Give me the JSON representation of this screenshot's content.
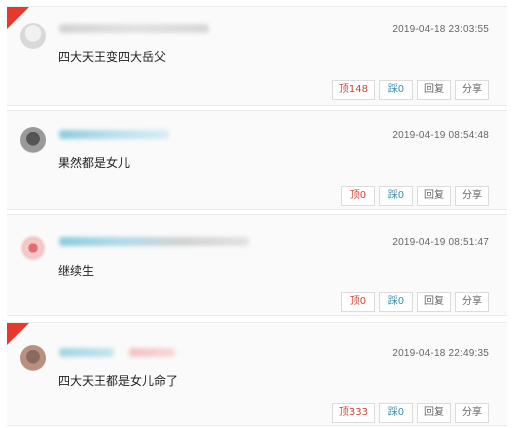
{
  "comments": [
    {
      "hot": true,
      "time": "2019-04-18 23:03:55",
      "text": "四大天王变四大岳父",
      "up_label": "顶148",
      "down_label": "踩0",
      "reply_label": "回复",
      "share_label": "分享"
    },
    {
      "hot": false,
      "time": "2019-04-19 08:54:48",
      "text": "果然都是女儿",
      "up_label": "顶0",
      "down_label": "踩0",
      "reply_label": "回复",
      "share_label": "分享"
    },
    {
      "hot": false,
      "time": "2019-04-19 08:51:47",
      "text": "继续生",
      "up_label": "顶0",
      "down_label": "踩0",
      "reply_label": "回复",
      "share_label": "分享"
    },
    {
      "hot": true,
      "time": "2019-04-18 22:49:35",
      "text": "四大天王都是女儿命了",
      "up_label": "顶333",
      "down_label": "踩0",
      "reply_label": "回复",
      "share_label": "分享"
    }
  ],
  "colors": {
    "hot_flag": "#e8372c",
    "up": "#d0443a",
    "down": "#3b8fa8"
  }
}
